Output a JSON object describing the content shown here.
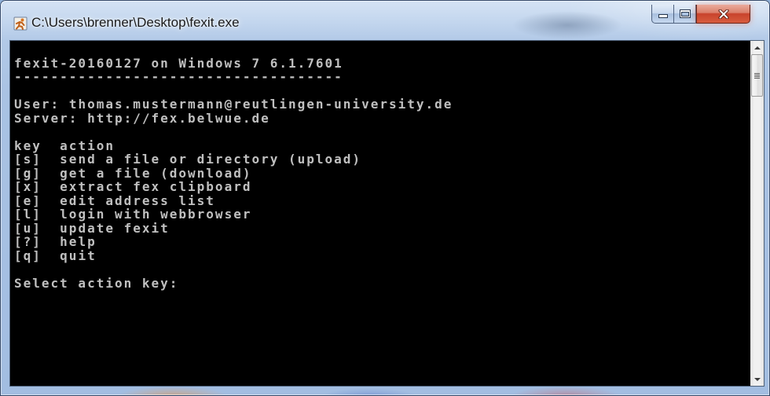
{
  "window": {
    "title": "C:\\Users\\brenner\\Desktop\\fexit.exe",
    "icon": "fexit-app-icon",
    "controls": [
      "minimize-icon",
      "maximize-icon",
      "close-icon"
    ]
  },
  "console": {
    "header": "fexit-20160127 on Windows 7 6.1.7601",
    "header_rule": "------------------------------------",
    "user": {
      "label": "User:",
      "value": "thomas.mustermann@reutlingen-university.de"
    },
    "server": {
      "label": "Server:",
      "value": "http://fex.belwue.de"
    },
    "menu_header": {
      "key": "key",
      "action": "action"
    },
    "menu": [
      {
        "key": "[s]",
        "action": "send a file or directory (upload)"
      },
      {
        "key": "[g]",
        "action": "get a file (download)"
      },
      {
        "key": "[x]",
        "action": "extract fex clipboard"
      },
      {
        "key": "[e]",
        "action": "edit address list"
      },
      {
        "key": "[l]",
        "action": "login with webbrowser"
      },
      {
        "key": "[u]",
        "action": "update fexit"
      },
      {
        "key": "[?]",
        "action": "help"
      },
      {
        "key": "[q]",
        "action": "quit"
      }
    ],
    "prompt": "Select action key:"
  },
  "scrollbar": {
    "position": 0,
    "icons": [
      "arrow-up-icon",
      "grip-icon",
      "arrow-down-icon"
    ]
  },
  "colors": {
    "console_background": "#000000",
    "console_text": "#c0c0c0",
    "frame": "#a9c2e3",
    "close_button": "#c8432c"
  }
}
